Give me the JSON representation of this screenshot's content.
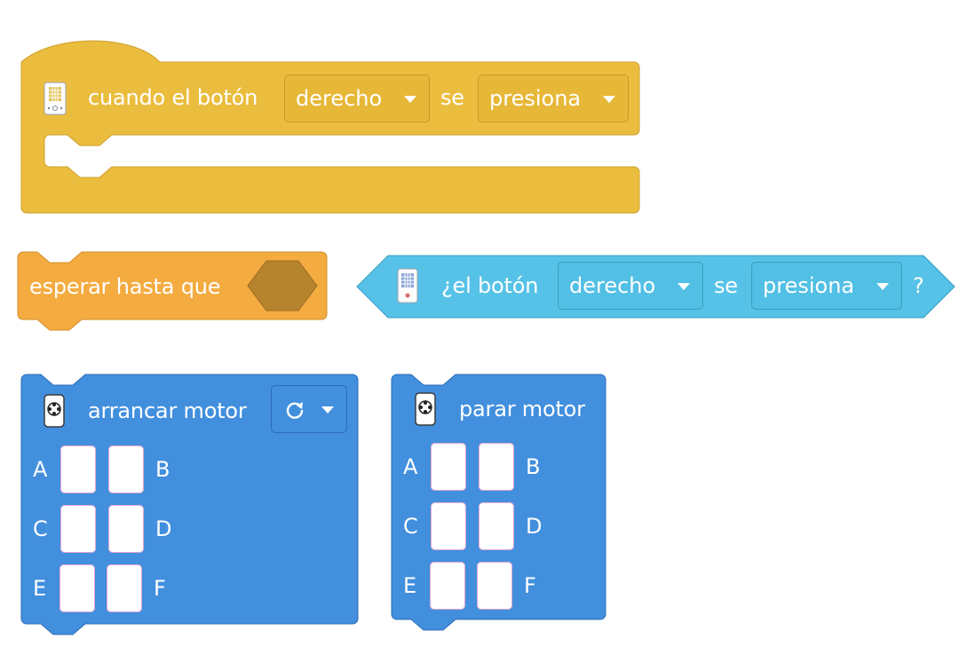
{
  "hat_block": {
    "text_when": "cuando el botón",
    "button_value": "derecho",
    "text_se": "se",
    "action_value": "presiona",
    "color": "#ebbd3e"
  },
  "wait_block": {
    "label": "esperar hasta que",
    "color": "#f4ab40",
    "slot_color": "#b7842e"
  },
  "sensor_block": {
    "text_the_button": "¿el botón",
    "button_value": "derecho",
    "text_se": "se",
    "action_value": "presiona",
    "text_question": "?",
    "color": "#56c2e7"
  },
  "start_motor_block": {
    "label": "arrancar motor",
    "direction_icon": "rotate-clockwise-icon",
    "ports": {
      "a": "A",
      "b": "B",
      "c": "C",
      "d": "D",
      "e": "E",
      "f": "F"
    },
    "color": "#428fde"
  },
  "stop_motor_block": {
    "label": "parar motor",
    "ports": {
      "a": "A",
      "b": "B",
      "c": "C",
      "d": "D",
      "e": "E",
      "f": "F"
    },
    "color": "#428fde"
  },
  "icons": {
    "controller": "controller-icon",
    "motor": "motor-icon"
  }
}
